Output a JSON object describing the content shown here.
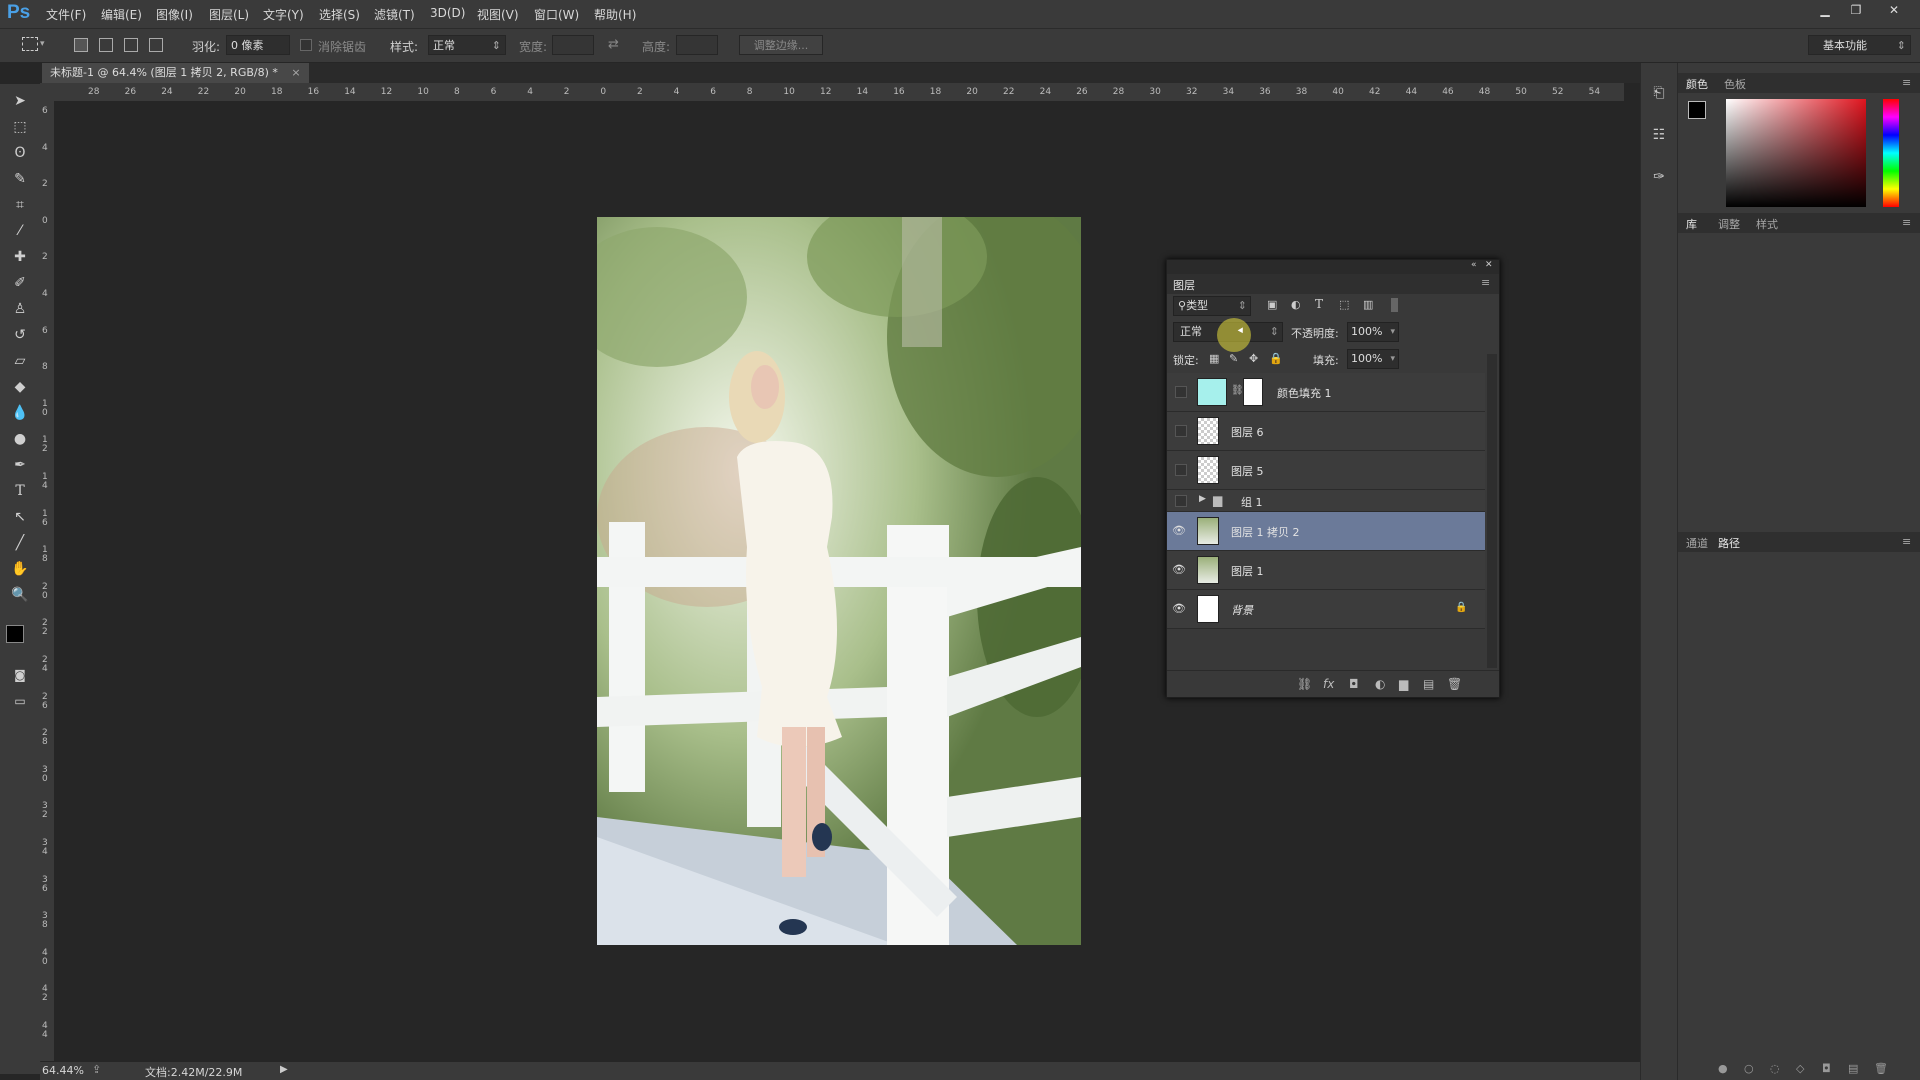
{
  "app": {
    "logo": "Ps"
  },
  "menu": [
    "文件(F)",
    "编辑(E)",
    "图像(I)",
    "图层(L)",
    "文字(Y)",
    "选择(S)",
    "滤镜(T)",
    "3D(D)",
    "视图(V)",
    "窗口(W)",
    "帮助(H)"
  ],
  "options": {
    "feather_label": "羽化:",
    "feather_value": "0 像素",
    "antialias_label": "消除锯齿",
    "style_label": "样式:",
    "style_value": "正常",
    "width_label": "宽度:",
    "height_label": "高度:",
    "refine_edge": "调整边缘...",
    "workspace": "基本功能"
  },
  "document": {
    "tab_title": "未标题-1 @ 64.4% (图层 1 拷贝 2, RGB/8) *"
  },
  "ruler": {
    "h": [
      "28",
      "26",
      "24",
      "22",
      "20",
      "18",
      "16",
      "14",
      "12",
      "10",
      "8",
      "6",
      "4",
      "2",
      "0",
      "2",
      "4",
      "6",
      "8",
      "10",
      "12",
      "14",
      "16",
      "18",
      "20",
      "22",
      "24",
      "26",
      "28",
      "30",
      "32",
      "34",
      "36",
      "38",
      "40",
      "42",
      "44",
      "46",
      "48",
      "50",
      "52",
      "54"
    ],
    "v": [
      "6",
      "4",
      "2",
      "0",
      "2",
      "4",
      "6",
      "8",
      "1 0",
      "1 2",
      "1 4",
      "1 6",
      "1 8",
      "2 0",
      "2 2",
      "2 4",
      "2 6",
      "2 8",
      "3 0",
      "3 2",
      "3 4",
      "3 6",
      "3 8",
      "4 0",
      "4 2",
      "4 4"
    ]
  },
  "status": {
    "zoom": "64.44%",
    "doc_size": "文档:2.42M/22.9M"
  },
  "right_panels": {
    "color_tabs": [
      "颜色",
      "色板"
    ],
    "lib_tabs": [
      "库",
      "调整",
      "样式"
    ],
    "channel_tabs": [
      "通道",
      "路径"
    ]
  },
  "layers_panel": {
    "title": "图层",
    "filter_kind": "类型",
    "blend_mode": "正常",
    "opacity_label": "不透明度:",
    "opacity_value": "100%",
    "lock_label": "锁定:",
    "fill_label": "填充:",
    "fill_value": "100%",
    "layers": [
      {
        "name": "颜色填充 1",
        "visible": false,
        "type": "fill",
        "fill_color": "#a6f0ec"
      },
      {
        "name": "图层 6",
        "visible": false,
        "type": "empty"
      },
      {
        "name": "图层 5",
        "visible": false,
        "type": "empty"
      },
      {
        "name": "组 1",
        "visible": false,
        "type": "group"
      },
      {
        "name": "图层 1 拷贝 2",
        "visible": true,
        "type": "photo",
        "selected": true
      },
      {
        "name": "图层 1",
        "visible": true,
        "type": "photo"
      },
      {
        "name": "背景",
        "visible": true,
        "type": "background",
        "locked": true
      }
    ]
  },
  "colors": {
    "accent_selected": "#6b7a99",
    "ps_blue": "#4aa0e6"
  }
}
